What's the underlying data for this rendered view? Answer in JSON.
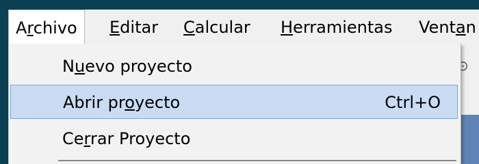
{
  "menubar": {
    "items": [
      {
        "before": "A",
        "mnemonic": "r",
        "after": "chivo"
      },
      {
        "before": "",
        "mnemonic": "E",
        "after": "ditar"
      },
      {
        "before": "",
        "mnemonic": "C",
        "after": "alcular"
      },
      {
        "before": "",
        "mnemonic": "H",
        "after": "erramientas"
      },
      {
        "before": "Vent",
        "mnemonic": "a",
        "after": "n"
      }
    ]
  },
  "archivo_menu": {
    "items": [
      {
        "before": "N",
        "mnemonic": "u",
        "after": "evo proyecto",
        "shortcut": ""
      },
      {
        "before": "Abrir pr",
        "mnemonic": "o",
        "after": "yecto",
        "shortcut": "Ctrl+O"
      },
      {
        "before": "Ce",
        "mnemonic": "r",
        "after": "rar Proyecto",
        "shortcut": ""
      }
    ]
  },
  "colors": {
    "background": "#0b3f52",
    "menubar": "#f0f0f0",
    "highlight": "#c9dcf4",
    "highlight_border": "#7ba6d9"
  }
}
